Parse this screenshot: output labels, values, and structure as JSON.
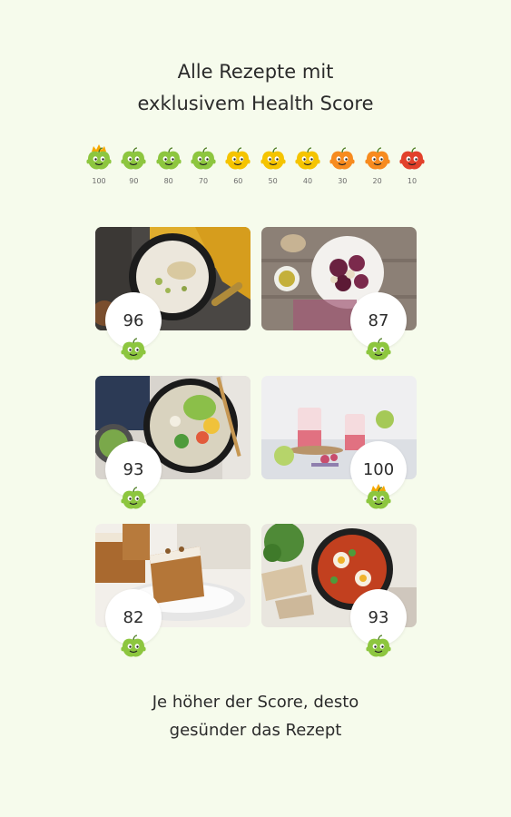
{
  "headline": {
    "line1": "Alle Rezepte mit",
    "line2": "exklusivem Health Score"
  },
  "scale": [
    {
      "label": "100",
      "color": "#8dc63f",
      "icon": "crowned-apple-icon"
    },
    {
      "label": "90",
      "color": "#8dc63f",
      "icon": "green-apple-icon"
    },
    {
      "label": "80",
      "color": "#8dc63f",
      "icon": "green-apple-icon"
    },
    {
      "label": "70",
      "color": "#8dc63f",
      "icon": "green-apple-icon"
    },
    {
      "label": "60",
      "color": "#f5c400",
      "icon": "yellow-apple-icon"
    },
    {
      "label": "50",
      "color": "#f5c400",
      "icon": "yellow-apple-icon"
    },
    {
      "label": "40",
      "color": "#f5c400",
      "icon": "yellow-apple-icon"
    },
    {
      "label": "30",
      "color": "#f78b1f",
      "icon": "orange-apple-icon"
    },
    {
      "label": "20",
      "color": "#f78b1f",
      "icon": "orange-apple-icon"
    },
    {
      "label": "10",
      "color": "#e2412b",
      "icon": "red-apple-icon"
    }
  ],
  "recipes": [
    {
      "score": "96",
      "image": "rice-pear-bowl",
      "crown": false
    },
    {
      "score": "87",
      "image": "beetroot-plate",
      "crown": false
    },
    {
      "score": "93",
      "image": "noodle-salad-bowl",
      "crown": false
    },
    {
      "score": "100",
      "image": "berry-drink-glasses",
      "crown": true
    },
    {
      "score": "82",
      "image": "carrot-cake",
      "crown": false
    },
    {
      "score": "93",
      "image": "shakshuka-pan",
      "crown": false
    }
  ],
  "footer": {
    "line1": "Je höher der Score, desto",
    "line2": "gesünder das Rezept"
  },
  "colors": {
    "background": "#f6fbec",
    "green_apple": "#8dc63f",
    "yellow_apple": "#f5c400",
    "orange_apple": "#f78b1f",
    "red_apple": "#e2412b",
    "crown": "#f6a800"
  }
}
